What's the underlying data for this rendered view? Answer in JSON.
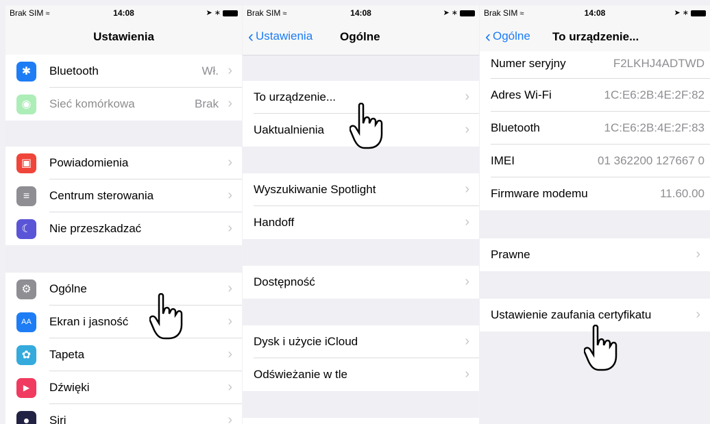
{
  "panel1": {
    "status": {
      "carrier": "Brak SIM",
      "time": "14:08"
    },
    "title": "Ustawienia",
    "rows": [
      {
        "label": "Bluetooth",
        "value": "Wł.",
        "icon_color": "#1e7df5",
        "icon": "bluetooth-icon"
      },
      {
        "label": "Sieć komórkowa",
        "value": "Brak",
        "icon_color": "#4cd964",
        "icon": "cellular-icon",
        "disabled": true
      },
      {
        "label": "Powiadomienia",
        "value": "",
        "icon_color": "#f0453a",
        "icon": "notifications-icon"
      },
      {
        "label": "Centrum sterowania",
        "value": "",
        "icon_color": "#8e8e93",
        "icon": "control-center-icon"
      },
      {
        "label": "Nie przeszkadzać",
        "value": "",
        "icon_color": "#5a55d6",
        "icon": "moon-icon"
      },
      {
        "label": "Ogólne",
        "value": "",
        "icon_color": "#8e8e93",
        "icon": "gear-icon"
      },
      {
        "label": "Ekran i jasność",
        "value": "",
        "icon_color": "#1e7df5",
        "icon": "display-icon",
        "icon_text": "AA"
      },
      {
        "label": "Tapeta",
        "value": "",
        "icon_color": "#35aadc",
        "icon": "wallpaper-icon"
      },
      {
        "label": "Dźwięki",
        "value": "",
        "icon_color": "#f03a5f",
        "icon": "sounds-icon"
      },
      {
        "label": "Siri",
        "value": "",
        "icon_color": "#222244",
        "icon": "siri-icon"
      }
    ]
  },
  "panel2": {
    "status": {
      "carrier": "Brak SIM",
      "time": "14:08"
    },
    "back": "Ustawienia",
    "title": "Ogólne",
    "rows": [
      {
        "label": "To urządzenie..."
      },
      {
        "label": "Uaktualnienia"
      },
      {
        "label": "Wyszukiwanie Spotlight"
      },
      {
        "label": "Handoff"
      },
      {
        "label": "Dostępność"
      },
      {
        "label": "Dysk i użycie iCloud"
      },
      {
        "label": "Odświeżanie w tle"
      }
    ]
  },
  "panel3": {
    "status": {
      "carrier": "Brak SIM",
      "time": "14:08"
    },
    "back": "Ogólne",
    "title": "To urządzenie...",
    "rows": [
      {
        "label": "Numer seryjny",
        "value": "F2LKHJ4ADTWD"
      },
      {
        "label": "Adres Wi-Fi",
        "value": "1C:E6:2B:4E:2F:82"
      },
      {
        "label": "Bluetooth",
        "value": "1C:E6:2B:4E:2F:83"
      },
      {
        "label": "IMEI",
        "value": "01 362200 127667 0"
      },
      {
        "label": "Firmware modemu",
        "value": "11.60.00"
      },
      {
        "label": "Prawne",
        "value": ""
      },
      {
        "label": "Ustawienie zaufania certyfikatu",
        "value": ""
      }
    ]
  }
}
